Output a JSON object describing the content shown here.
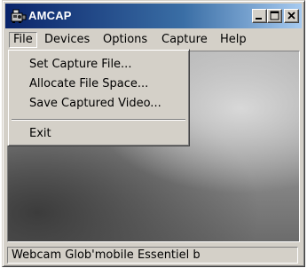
{
  "window": {
    "title": "AMCAP",
    "title_gradient": [
      "#0a246a",
      "#a6caf0"
    ]
  },
  "menubar": {
    "items": [
      "File",
      "Devices",
      "Options",
      "Capture",
      "Help"
    ]
  },
  "file_menu": {
    "items": [
      "Set Capture File...",
      "Allocate File Space...",
      "Save Captured Video...",
      "Exit"
    ]
  },
  "statusbar": {
    "text": "Webcam Glob'mobile Essentiel b"
  },
  "icons": {
    "app": "webcam-app-icon",
    "minimize": "minimize-icon",
    "maximize": "maximize-icon",
    "close": "close-icon"
  }
}
